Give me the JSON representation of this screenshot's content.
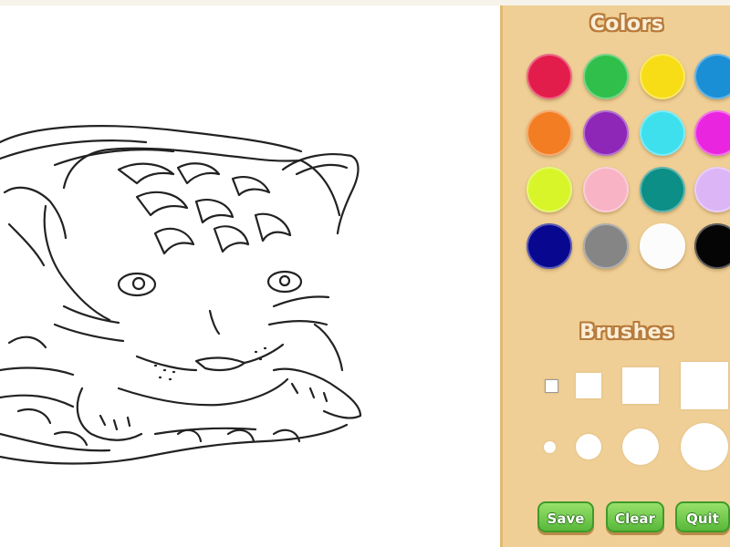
{
  "colors_panel": {
    "title": "Colors",
    "swatches": [
      {
        "name": "red",
        "hex": "#e31d4b"
      },
      {
        "name": "green",
        "hex": "#2fbf4a"
      },
      {
        "name": "yellow",
        "hex": "#f7dd16"
      },
      {
        "name": "blue",
        "hex": "#1b8fd6"
      },
      {
        "name": "orange",
        "hex": "#f37d22"
      },
      {
        "name": "purple",
        "hex": "#8e27b8"
      },
      {
        "name": "cyan",
        "hex": "#3fe0ee"
      },
      {
        "name": "magenta",
        "hex": "#ea25e0"
      },
      {
        "name": "lime",
        "hex": "#d8f52a"
      },
      {
        "name": "pink",
        "hex": "#f8b3c4"
      },
      {
        "name": "teal",
        "hex": "#0b8f86"
      },
      {
        "name": "lavender",
        "hex": "#dcb5f6"
      },
      {
        "name": "navy",
        "hex": "#07078f"
      },
      {
        "name": "gray",
        "hex": "#858585"
      },
      {
        "name": "white",
        "hex": "#fcfcfc"
      },
      {
        "name": "black",
        "hex": "#050505"
      }
    ]
  },
  "brushes_panel": {
    "title": "Brushes",
    "shapes": [
      "square",
      "circle"
    ],
    "sizes": [
      "small",
      "medium",
      "large",
      "extra-large"
    ]
  },
  "actions": {
    "save_label": "Save",
    "clear_label": "Clear",
    "quit_label": "Quit"
  },
  "theme": {
    "panel_bg": "#efcf95",
    "title_outline": "#b77a3b",
    "button_green": "#58b83a"
  },
  "canvas": {
    "line_color": "#222222",
    "subject": "tiger-cub-line-art"
  }
}
